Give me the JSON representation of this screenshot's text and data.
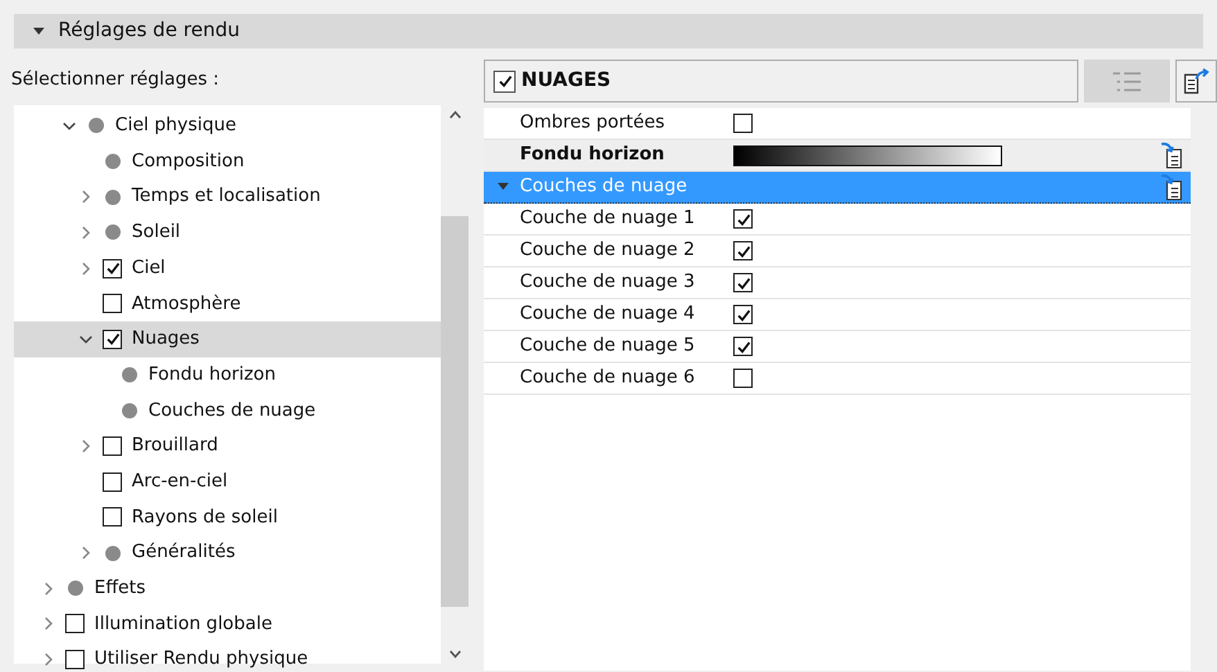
{
  "section": {
    "title": "Réglages de rendu",
    "expanded": true
  },
  "select_label": "Sélectionner réglages :",
  "tree": {
    "partial_branch": [
      {
        "label": "Ciel physique",
        "kind": "dot",
        "has_children": true,
        "expanded": true,
        "selected": false,
        "children": [
          {
            "label": "Composition",
            "kind": "dot",
            "has_children": false,
            "selected": false
          },
          {
            "label": "Temps et localisation",
            "kind": "dot",
            "has_children": true,
            "expanded": false,
            "selected": false
          },
          {
            "label": "Soleil",
            "kind": "dot",
            "has_children": true,
            "expanded": false,
            "selected": false
          },
          {
            "label": "Ciel",
            "kind": "checkbox",
            "checked": true,
            "has_children": true,
            "expanded": false,
            "selected": false
          },
          {
            "label": "Atmosphère",
            "kind": "checkbox",
            "checked": false,
            "has_children": false,
            "selected": false
          },
          {
            "label": "Nuages",
            "kind": "checkbox",
            "checked": true,
            "has_children": true,
            "expanded": true,
            "selected": true,
            "children": [
              {
                "label": "Fondu horizon",
                "kind": "dot",
                "has_children": false,
                "selected": false
              },
              {
                "label": "Couches de nuage",
                "kind": "dot",
                "has_children": false,
                "selected": false
              }
            ]
          },
          {
            "label": "Brouillard",
            "kind": "checkbox",
            "checked": false,
            "has_children": true,
            "expanded": false,
            "selected": false
          },
          {
            "label": "Arc-en-ciel",
            "kind": "checkbox",
            "checked": false,
            "has_children": false,
            "selected": false
          },
          {
            "label": "Rayons de soleil",
            "kind": "checkbox",
            "checked": false,
            "has_children": false,
            "selected": false
          },
          {
            "label": "Généralités",
            "kind": "dot",
            "has_children": true,
            "expanded": false,
            "selected": false
          }
        ]
      }
    ],
    "items": [
      {
        "label": "Effets",
        "kind": "dot",
        "has_children": true,
        "expanded": false,
        "selected": false
      },
      {
        "label": "Illumination globale",
        "kind": "checkbox",
        "checked": false,
        "has_children": true,
        "expanded": false,
        "selected": false
      },
      {
        "label": "Utiliser Rendu physique",
        "kind": "checkbox",
        "checked": false,
        "has_children": true,
        "expanded": false,
        "selected": false
      }
    ]
  },
  "panel": {
    "title": "NUAGES",
    "checked": true
  },
  "properties": [
    {
      "kind": "checkbox",
      "label": "Ombres portées",
      "checked": false
    },
    {
      "kind": "gradient",
      "label": "Fondu horizon"
    },
    {
      "kind": "group",
      "label": "Couches de nuage",
      "expanded": true,
      "selected": true
    },
    {
      "kind": "checkbox",
      "label": "Couche de nuage 1",
      "checked": true
    },
    {
      "kind": "checkbox",
      "label": "Couche de nuage 2",
      "checked": true
    },
    {
      "kind": "checkbox",
      "label": "Couche de nuage 3",
      "checked": true
    },
    {
      "kind": "checkbox",
      "label": "Couche de nuage 4",
      "checked": true
    },
    {
      "kind": "checkbox",
      "label": "Couche de nuage 5",
      "checked": true
    },
    {
      "kind": "checkbox",
      "label": "Couche de nuage 6",
      "checked": false
    }
  ]
}
